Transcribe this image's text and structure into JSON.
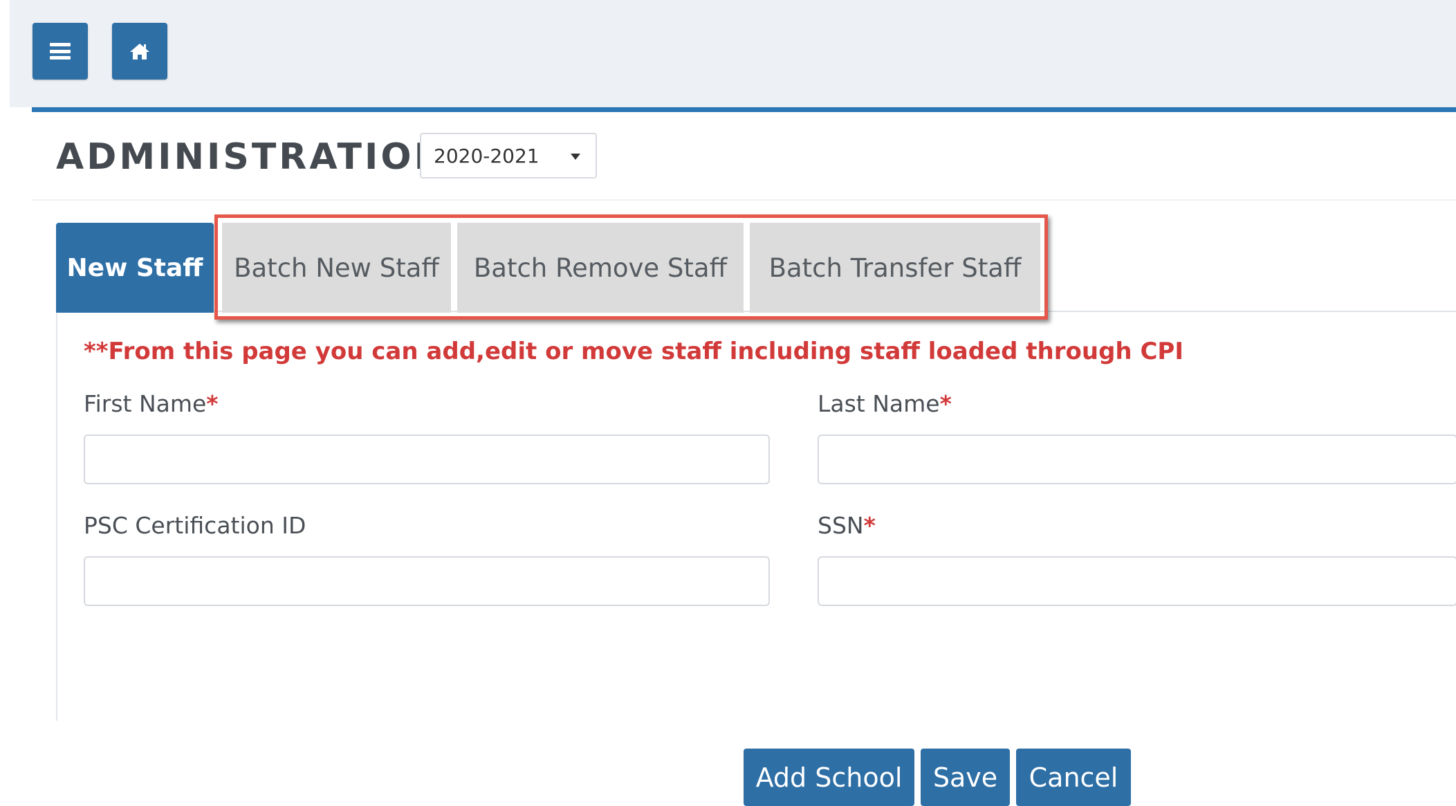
{
  "header": {
    "menu_icon": "hamburger-menu-icon",
    "home_icon": "home-icon"
  },
  "panel": {
    "title": "ADMINISTRATION",
    "year_select": {
      "selected": "2020-2021"
    }
  },
  "tabs": [
    {
      "label": "New Staff",
      "active": true
    },
    {
      "label": "Batch New Staff",
      "active": false
    },
    {
      "label": "Batch Remove Staff",
      "active": false
    },
    {
      "label": "Batch Transfer Staff",
      "active": false
    }
  ],
  "form": {
    "notice": "**From this page you can add,edit or move staff including staff loaded through CPI",
    "fields": {
      "first_name": {
        "label": "First Name",
        "required_mark": "*",
        "value": ""
      },
      "last_name": {
        "label": "Last Name",
        "required_mark": "*",
        "value": ""
      },
      "psc_id": {
        "label": "PSC Certification ID",
        "value": ""
      },
      "ssn": {
        "label": "SSN",
        "required_mark": "*",
        "value": ""
      }
    },
    "buttons": {
      "add_school": "Add School",
      "save": "Save",
      "cancel": "Cancel"
    }
  },
  "colors": {
    "primary": "#2e6fa6",
    "accent_border": "#2b76b6",
    "required": "#d23a3a",
    "highlight": "#e4574a"
  }
}
